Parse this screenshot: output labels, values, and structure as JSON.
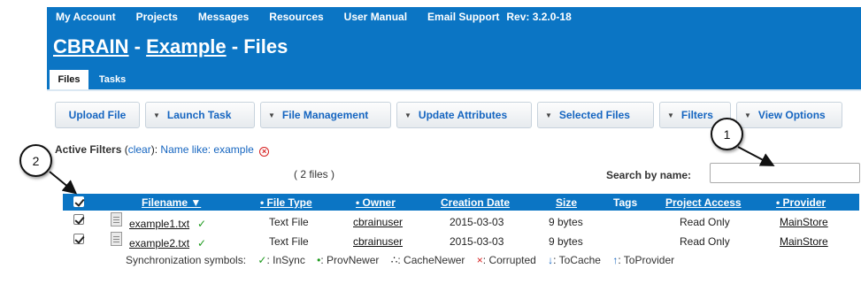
{
  "top_nav": {
    "items": [
      "My Account",
      "Projects",
      "Messages",
      "Resources",
      "User Manual",
      "Email Support"
    ],
    "revision": "Rev: 3.2.0-18"
  },
  "title": {
    "app": "CBRAIN",
    "sep1": " - ",
    "project": "Example",
    "sep2": " - ",
    "page": "Files"
  },
  "tabs": {
    "active": "Files",
    "other": "Tasks"
  },
  "toolbar": {
    "upload": "Upload File",
    "launch": "Launch Task",
    "file_mgmt": "File Management",
    "update_attr": "Update Attributes",
    "selected": "Selected Files",
    "filters": "Filters",
    "view": "View Options"
  },
  "filters": {
    "label": "Active Filters",
    "clear_pre": " (",
    "clear": "clear",
    "clear_post": "): ",
    "value": "Name like: example"
  },
  "file_count": "( 2 files )",
  "search": {
    "label": "Search by name:",
    "placeholder": ""
  },
  "table": {
    "headers": {
      "filename": "Filename ▼",
      "filetype": "• File Type",
      "owner": "• Owner",
      "created": "Creation Date",
      "size": "Size",
      "tags": "Tags",
      "access": "Project Access",
      "provider": "• Provider"
    },
    "rows": [
      {
        "name": "example1.txt",
        "status": "✓",
        "type": "Text File",
        "owner": "cbrainuser",
        "date": "2015-03-03",
        "size": "9 bytes",
        "access": "Read Only",
        "provider": "MainStore"
      },
      {
        "name": "example2.txt",
        "status": "✓",
        "type": "Text File",
        "owner": "cbrainuser",
        "date": "2015-03-03",
        "size": "9 bytes",
        "access": "Read Only",
        "provider": "MainStore"
      }
    ]
  },
  "sync": {
    "label": "Synchronization symbols:",
    "insync_sym": "✓",
    "insync": ": InSync",
    "provnewer_sym": "•",
    "provnewer": ": ProvNewer",
    "cachenewer_sym": "∴",
    "cachenewer": ": CacheNewer",
    "corrupted_sym": "×",
    "corrupted": ": Corrupted",
    "tocache_sym": "↓",
    "tocache": ": ToCache",
    "toprovider_sym": "↑",
    "toprovider": ": ToProvider"
  },
  "callouts": [
    "1",
    "2"
  ],
  "colors": {
    "brand_blue": "#0b75c4",
    "link_blue": "#1565c0",
    "ok_green": "#1e9a1e",
    "error_red": "#d62020"
  }
}
